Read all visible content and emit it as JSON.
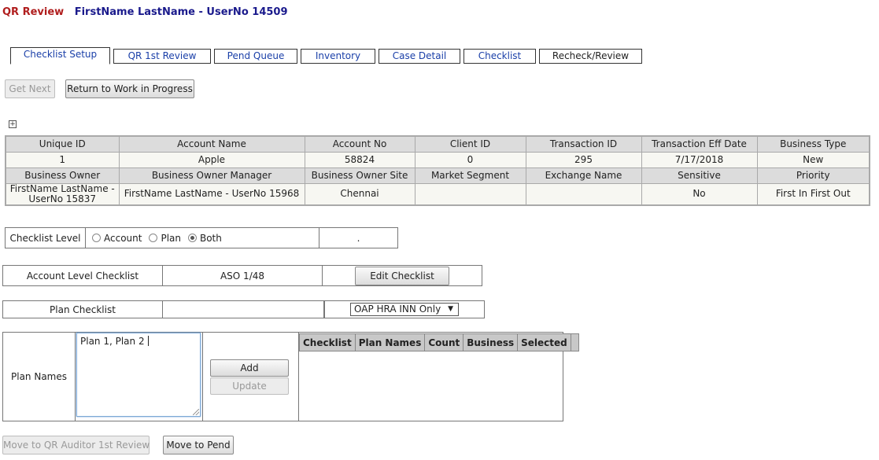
{
  "header": {
    "app_title": "QR Review",
    "user_title": "FirstName LastName - UserNo 14509"
  },
  "tabs": [
    {
      "label": "Checklist Setup",
      "active": true
    },
    {
      "label": "QR 1st Review"
    },
    {
      "label": "Pend Queue"
    },
    {
      "label": "Inventory"
    },
    {
      "label": "Case Detail"
    },
    {
      "label": "Checklist"
    },
    {
      "label": "Recheck/Review"
    }
  ],
  "actions": {
    "get_next": "Get Next",
    "return_wip": "Return to Work in Progress"
  },
  "expand_icon": "plus-box-icon",
  "info_table": {
    "headers1": [
      "Unique ID",
      "Account Name",
      "Account No",
      "Client ID",
      "Transaction ID",
      "Transaction Eff Date",
      "Business Type"
    ],
    "values1": [
      "1",
      "Apple",
      "58824",
      "0",
      "295",
      "7/17/2018",
      "New"
    ],
    "headers2": [
      "Business Owner",
      "Business Owner Manager",
      "Business Owner Site",
      "Market Segment",
      "Exchange Name",
      "Sensitive",
      "Priority"
    ],
    "values2": [
      "FirstName LastName - UserNo 15837",
      "FirstName LastName - UserNo 15968",
      "Chennai",
      "",
      "",
      "No",
      "First In First Out"
    ]
  },
  "checklist_level": {
    "label": "Checklist Level",
    "options": [
      "Account",
      "Plan",
      "Both"
    ],
    "selected": "Both",
    "extra": "."
  },
  "account_checklist": {
    "label": "Account Level Checklist",
    "value": "ASO 1/48",
    "edit_button": "Edit Checklist"
  },
  "plan_checklist": {
    "label": "Plan Checklist",
    "value": "",
    "select_value": "OAP HRA INN Only"
  },
  "plan_names": {
    "label": "Plan Names",
    "input_value": "Plan 1, Plan 2 ",
    "add_button": "Add",
    "update_button": "Update",
    "grid_headers": [
      "Checklist",
      "Plan Names",
      "Count",
      "Business",
      "Selected"
    ]
  },
  "bottom": {
    "move_qr": "Move to QR Auditor 1st Review",
    "move_pend": "Move to Pend"
  }
}
